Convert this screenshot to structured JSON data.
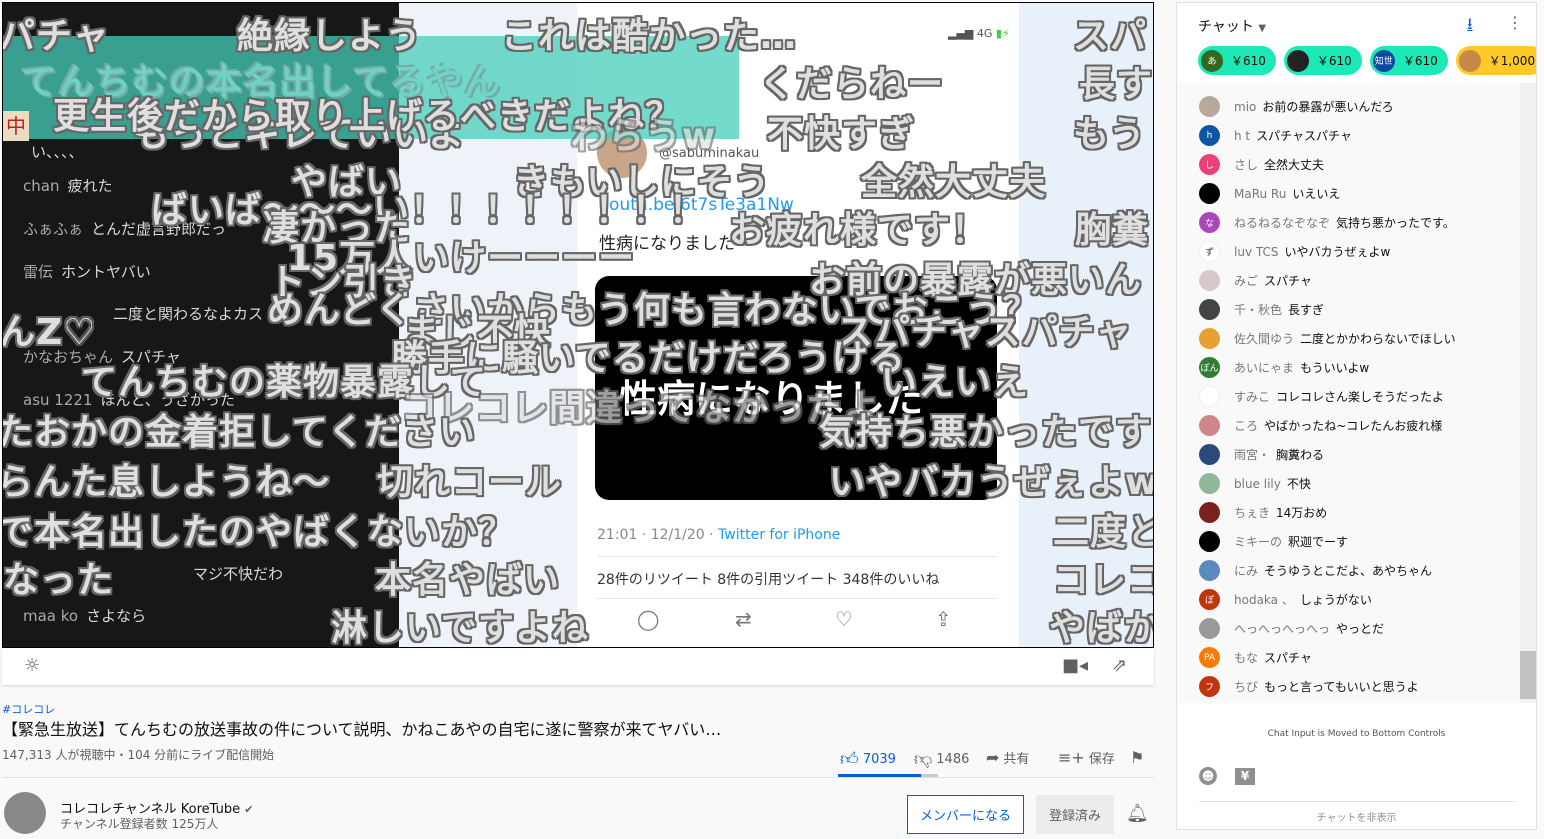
{
  "video": {
    "inner_chat": [
      {
        "author": "",
        "text": "い、、、、"
      },
      {
        "author": "chan",
        "text": "疲れた"
      },
      {
        "author": "ふぁふぁ",
        "text": "とんだ虚言野郎だっ"
      },
      {
        "author": "雷伝",
        "text": "ホントヤバい"
      },
      {
        "author": "",
        "text": "二度と関わるなよカス"
      },
      {
        "author": "かなおちゃん",
        "text": "スパチャ"
      },
      {
        "author": "asu 1221",
        "text": "ほんと、うざかった"
      },
      {
        "author": "",
        "text": "マジ不快だわ"
      },
      {
        "author": "maa ko",
        "text": "さよなら"
      }
    ],
    "tweet": {
      "status_network": "4G",
      "handle": "@sabuminakau",
      "link": "youtu.be/6t7sTe3a1Nw",
      "text": "性病になりました",
      "timestamp": "21:01 · 12/1/20 · ",
      "source": "Twitter for iPhone",
      "stats": "28件のリツイート  8件の引用ツイート  348件のいいね",
      "image_caption": "性病になりました"
    },
    "tile_icon": "中",
    "danmaku": [
      "パチャ",
      "絶縁しよう",
      "これは酷かった…",
      "スパ",
      "てんちむの本名出してるやん",
      "更生後だから取り上げるべきだよね？",
      "もっとキレていいよ",
      "くだらねー",
      "長す",
      "不快すぎ",
      "もう",
      "わらうw",
      "やばい",
      "きもいしにそう",
      "全然大丈夫",
      "ばいば～～～い！！！！！！！！",
      "凄かった",
      "お疲れ様です！",
      "胸糞",
      "15万人いけーーーー",
      "お前の暴露が悪いん",
      "トン引き",
      "めんどくさいからもう何も言わないでおこう？",
      "んZ♡",
      "まじ不快",
      "スパチャスパチャ",
      "勝手に騒いでるだけだろうける",
      "てんちむの薬物暴露して",
      "いえいえ",
      "コレコレ間違ってなかったよ",
      "たおかの金着拒してください",
      "気持ち悪かったです",
      "らんた息しようね～",
      "切れコール",
      "いやバカうぜぇよw",
      "で本名出したのやばくないか？",
      "二度と",
      "なった",
      "本名やばい",
      "コレコ",
      "淋しいですよね",
      "やばか"
    ]
  },
  "controls": {
    "brightness_icon": "brightness-icon",
    "camera_icon": "video-camera-icon",
    "share_icon": "share-icon"
  },
  "info": {
    "hashtag": "#コレコレ",
    "title": "【緊急生放送】てんちむの放送事故の件について説明、かねこあやの自宅に遂に警察が来てヤバい…",
    "views": "147,313 人が視聴中・104 分前にライブ配信開始",
    "likes": "7039",
    "dislikes": "1486",
    "like_ratio": 0.83,
    "share": "共有",
    "save": "保存",
    "channel_name": "コレコレチャンネル KoreTube",
    "subscribers": "チャンネル登録者数 125万人",
    "member_btn": "メンバーになる",
    "subscribed_btn": "登録済み"
  },
  "chat": {
    "header": "チャット",
    "tickers": [
      {
        "avatar": "あ",
        "amount": "￥610",
        "color": "#1de9b6",
        "avcolor": "#33691e"
      },
      {
        "avatar": "",
        "amount": "￥610",
        "color": "#1de9b6",
        "avcolor": "#222"
      },
      {
        "avatar": "知世",
        "amount": "￥610",
        "color": "#1de9b6",
        "avcolor": "#0d47a1"
      },
      {
        "avatar": "",
        "amount": "￥1,000",
        "color": "#ffca28",
        "avcolor": "#c58a4a"
      }
    ],
    "messages": [
      {
        "avatar": "",
        "author": "mio",
        "text": "お前の暴露が悪いんだろ",
        "color": "#b8a89a"
      },
      {
        "avatar": "h",
        "author": "h t",
        "text": "スパチャスパチャ",
        "color": "#0b57a4"
      },
      {
        "avatar": "し",
        "author": "さし",
        "text": "全然大丈夫",
        "color": "#ec407a"
      },
      {
        "avatar": "",
        "author": "MaRu Ru",
        "text": "いえいえ",
        "color": "#000"
      },
      {
        "avatar": "な",
        "author": "ねるねるなぞなぞ",
        "text": "気持ち悪かったです。",
        "color": "#ab47bc"
      },
      {
        "avatar": "ず",
        "author": "luv TCS",
        "text": "いやバカうぜぇよw",
        "color": "#fff"
      },
      {
        "avatar": "",
        "author": "みご",
        "text": "スパチャ",
        "color": "#d8c8c8"
      },
      {
        "avatar": "",
        "author": "千・秋色",
        "text": "長すぎ",
        "color": "#444"
      },
      {
        "avatar": "",
        "author": "佐久間ゆう",
        "text": "二度とかかわらないでほしい",
        "color": "#e8a030"
      },
      {
        "avatar": "ぽん",
        "author": "あいにゃま",
        "text": "もういいよw",
        "color": "#2e7d32"
      },
      {
        "avatar": "",
        "author": "すみこ",
        "text": "コレコレさん楽しそうだったよ",
        "color": "#fff"
      },
      {
        "avatar": "",
        "author": "ころ",
        "text": "やばかったね~コレたんお疲れ様",
        "color": "#c88"
      },
      {
        "avatar": "",
        "author": "雨宮・",
        "text": "胸糞わる",
        "color": "#2a4a7a"
      },
      {
        "avatar": "",
        "author": "blue lily",
        "text": "不快",
        "color": "#8fb89a"
      },
      {
        "avatar": "",
        "author": "ちぇき",
        "text": "14万おめ",
        "color": "#7a2020"
      },
      {
        "avatar": "",
        "author": "ミキーの",
        "text": "釈迦でーす",
        "color": "#000"
      },
      {
        "avatar": "",
        "author": "にみ",
        "text": "そうゆうとこだよ、あやちゃん",
        "color": "#5a8ac0"
      },
      {
        "avatar": "ぽ",
        "author": "hodaka 、",
        "text": "しょうがない",
        "color": "#bf360c"
      },
      {
        "avatar": "",
        "author": "へっへっへっへっ",
        "text": "やっとだ",
        "color": "#999"
      },
      {
        "avatar": "PA",
        "author": "もな",
        "text": "スパチャ",
        "color": "#f57c00"
      },
      {
        "avatar": "フ",
        "author": "ちび",
        "text": "もっと言ってもいいと思うよ",
        "color": "#bf360c"
      }
    ],
    "moved_notice": "Chat Input is Moved to Bottom Controls",
    "yen_icon": "¥",
    "hide_chat": "チャットを非表示"
  }
}
